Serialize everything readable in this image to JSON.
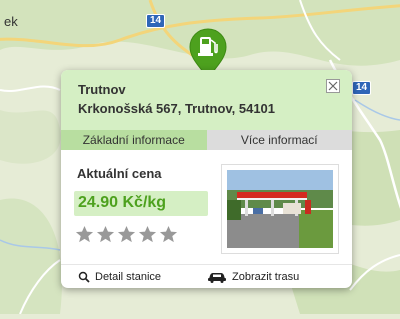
{
  "map": {
    "place_label": "ek",
    "road_number_top": "14",
    "road_number_right": "14"
  },
  "marker": {
    "icon": "fuel-pump-icon",
    "color": "#4da11e"
  },
  "popup": {
    "city": "Trutnov",
    "address": "Krkonošská 567, Trutnov, 54101",
    "tabs": [
      {
        "label": "Základní informace",
        "active": true
      },
      {
        "label": "Více informací",
        "active": false
      }
    ],
    "price_title": "Aktuální cena",
    "price_value": "24.90 Kč/kg",
    "rating": {
      "value": 0,
      "max": 5
    },
    "photo_alt": "fuel-station-photo",
    "footer": {
      "detail_label": "Detail stanice",
      "detail_icon": "search-icon",
      "route_label": "Zobrazit trasu",
      "route_icon": "car-icon"
    }
  },
  "colors": {
    "accent_green": "#4da11e",
    "header_bg": "#d5efc4",
    "tab_active_bg": "#b8dea0",
    "tab_inactive_bg": "#dcdcdc",
    "road_badge": "#2f66b8"
  }
}
